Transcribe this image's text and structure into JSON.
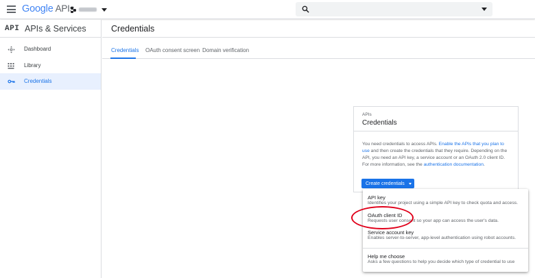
{
  "header": {
    "logo_google": "Google",
    "logo_apis": "APIs",
    "search": {
      "value": "",
      "placeholder": ""
    }
  },
  "sidenav": {
    "badge": "API",
    "title": "APIs & Services",
    "items": [
      {
        "label": "Dashboard",
        "icon": "dashboard-icon",
        "active": false
      },
      {
        "label": "Library",
        "icon": "library-icon",
        "active": false
      },
      {
        "label": "Credentials",
        "icon": "key-icon",
        "active": true
      }
    ]
  },
  "page": {
    "title": "Credentials",
    "tabs": [
      {
        "label": "Credentials",
        "active": true
      },
      {
        "label": "OAuth consent screen",
        "active": false
      },
      {
        "label": "Domain verification",
        "active": false
      }
    ]
  },
  "card": {
    "eyebrow": "APIs",
    "title": "Credentials",
    "body_1": "You need credentials to access APIs. ",
    "link_1": "Enable the APIs that you plan to use",
    "body_2": " and then create the credentials that they require. Depending on the API, you need an API key, a service account or an OAuth 2.0 client ID. For more information, see the ",
    "link_2": "authentication documentation",
    "body_3": ".",
    "button_label": "Create credentials"
  },
  "menu": {
    "items": [
      {
        "title": "API key",
        "description": "Identifies your project using a simple API key to check quota and access."
      },
      {
        "title": "OAuth client ID",
        "description": "Requests user consent so your app can access the user's data."
      },
      {
        "title": "Service account key",
        "description": "Enables server-to-server, app-level authentication using robot accounts."
      },
      {
        "title": "Help me choose",
        "description": "Asks a few questions to help you decide which type of credential to use"
      }
    ]
  },
  "colors": {
    "accent": "#1a73e8",
    "highlight": "#e0001a",
    "active_bg": "#e8f0fe"
  }
}
